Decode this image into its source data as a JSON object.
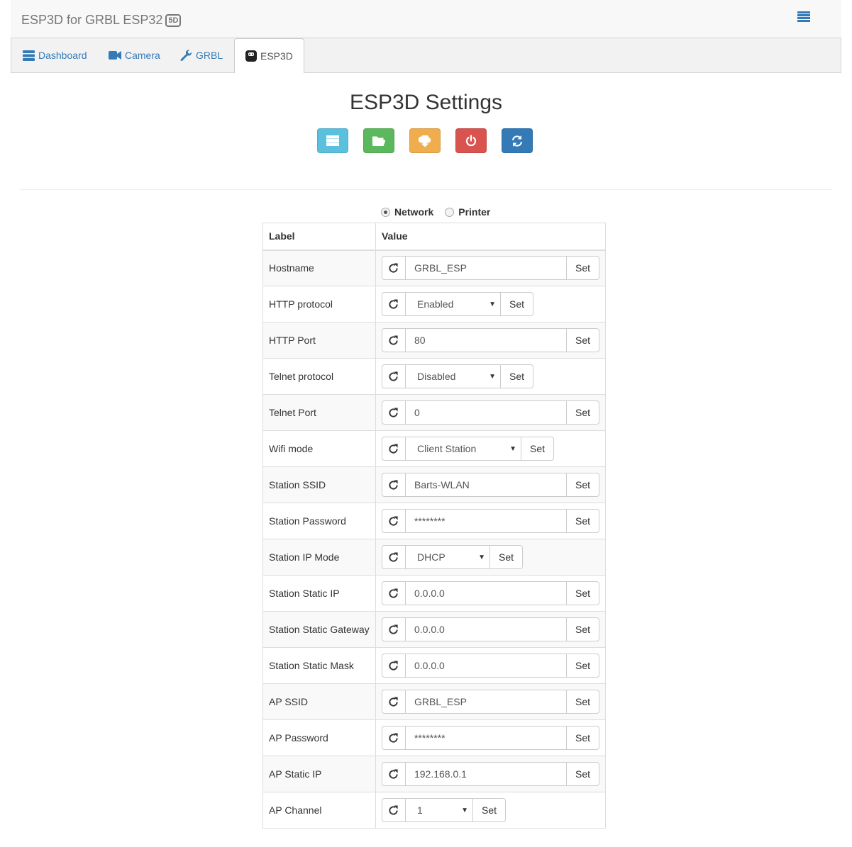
{
  "header": {
    "title": "ESP3D for GRBL ESP32",
    "badge": "5D"
  },
  "tabs": [
    {
      "label": "Dashboard",
      "icon": "dashboard-icon"
    },
    {
      "label": "Camera",
      "icon": "camera-icon"
    },
    {
      "label": "GRBL",
      "icon": "wrench-icon"
    },
    {
      "label": "ESP3D",
      "icon": "esp3d-icon",
      "active": true
    }
  ],
  "page_title": "ESP3D Settings",
  "action_buttons": [
    {
      "name": "list-icon",
      "color": "#5bc0de"
    },
    {
      "name": "folder-open-icon",
      "color": "#5cb85c"
    },
    {
      "name": "cloud-download-icon",
      "color": "#f0ad4e"
    },
    {
      "name": "power-icon",
      "color": "#d9534f"
    },
    {
      "name": "refresh-icon",
      "color": "#337ab7"
    }
  ],
  "filter": {
    "network_label": "Network",
    "printer_label": "Printer",
    "selected": "Network"
  },
  "table": {
    "headers": {
      "label": "Label",
      "value": "Value"
    },
    "set_label": "Set",
    "rows": [
      {
        "label": "Hostname",
        "type": "text",
        "value": "GRBL_ESP"
      },
      {
        "label": "HTTP protocol",
        "type": "select",
        "value": "Enabled"
      },
      {
        "label": "HTTP Port",
        "type": "text",
        "value": "80"
      },
      {
        "label": "Telnet protocol",
        "type": "select",
        "value": "Disabled"
      },
      {
        "label": "Telnet Port",
        "type": "text",
        "value": "0"
      },
      {
        "label": "Wifi mode",
        "type": "select",
        "value": "Client Station"
      },
      {
        "label": "Station SSID",
        "type": "text",
        "value": "Barts-WLAN"
      },
      {
        "label": "Station Password",
        "type": "text",
        "value": "********"
      },
      {
        "label": "Station IP Mode",
        "type": "select",
        "value": "DHCP"
      },
      {
        "label": "Station Static IP",
        "type": "text",
        "value": "0.0.0.0"
      },
      {
        "label": "Station Static Gateway",
        "type": "text",
        "value": "0.0.0.0"
      },
      {
        "label": "Station Static Mask",
        "type": "text",
        "value": "0.0.0.0"
      },
      {
        "label": "AP SSID",
        "type": "text",
        "value": "GRBL_ESP"
      },
      {
        "label": "AP Password",
        "type": "text",
        "value": "********"
      },
      {
        "label": "AP Static IP",
        "type": "text",
        "value": "192.168.0.1"
      },
      {
        "label": "AP Channel",
        "type": "select",
        "value": "1"
      }
    ]
  }
}
